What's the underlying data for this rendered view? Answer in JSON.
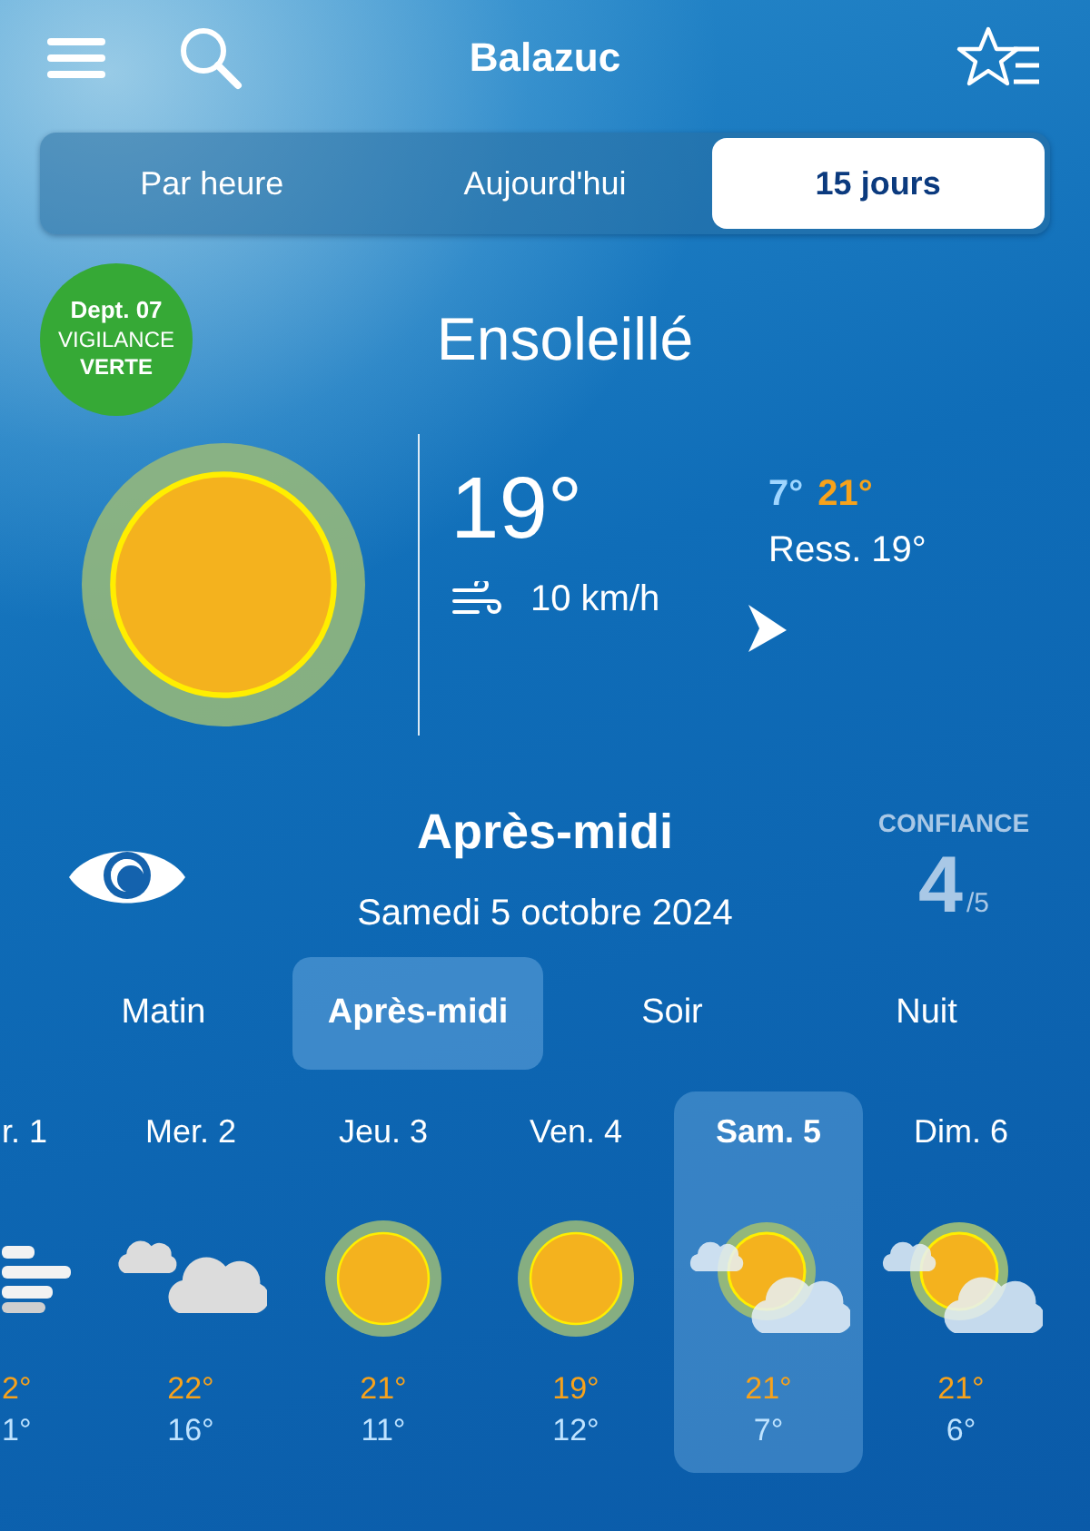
{
  "header": {
    "title": "Balazuc"
  },
  "tabs": [
    {
      "label": "Par heure",
      "selected": false
    },
    {
      "label": "Aujourd'hui",
      "selected": false
    },
    {
      "label": "15 jours",
      "selected": true
    }
  ],
  "vigilance": {
    "dept": "Dept. 07",
    "label": "VIGILANCE",
    "level": "VERTE"
  },
  "condition": "Ensoleillé",
  "current": {
    "temperature": "19°",
    "wind": "10 km/h",
    "min": "7°",
    "max": "21°",
    "feels_like": "Ress. 19°"
  },
  "period_title": "Après-midi",
  "date": "Samedi 5 octobre 2024",
  "confidence": {
    "label": "CONFIANCE",
    "value": "4",
    "scale": "/5"
  },
  "periods": [
    {
      "label": "Matin",
      "selected": false
    },
    {
      "label": "Après-midi",
      "selected": true
    },
    {
      "label": "Soir",
      "selected": false
    },
    {
      "label": "Nuit",
      "selected": false
    }
  ],
  "days": [
    {
      "label": "r. 1",
      "kind": "fog",
      "max": "2°",
      "min": "1°",
      "selected": false
    },
    {
      "label": "Mer. 2",
      "kind": "clouds",
      "max": "22°",
      "min": "16°",
      "selected": false
    },
    {
      "label": "Jeu. 3",
      "kind": "sun",
      "max": "21°",
      "min": "11°",
      "selected": false
    },
    {
      "label": "Ven. 4",
      "kind": "sun",
      "max": "19°",
      "min": "12°",
      "selected": false
    },
    {
      "label": "Sam. 5",
      "kind": "partly",
      "max": "21°",
      "min": "7°",
      "selected": true
    },
    {
      "label": "Dim. 6",
      "kind": "partly",
      "max": "21°",
      "min": "6°",
      "selected": false
    }
  ]
}
